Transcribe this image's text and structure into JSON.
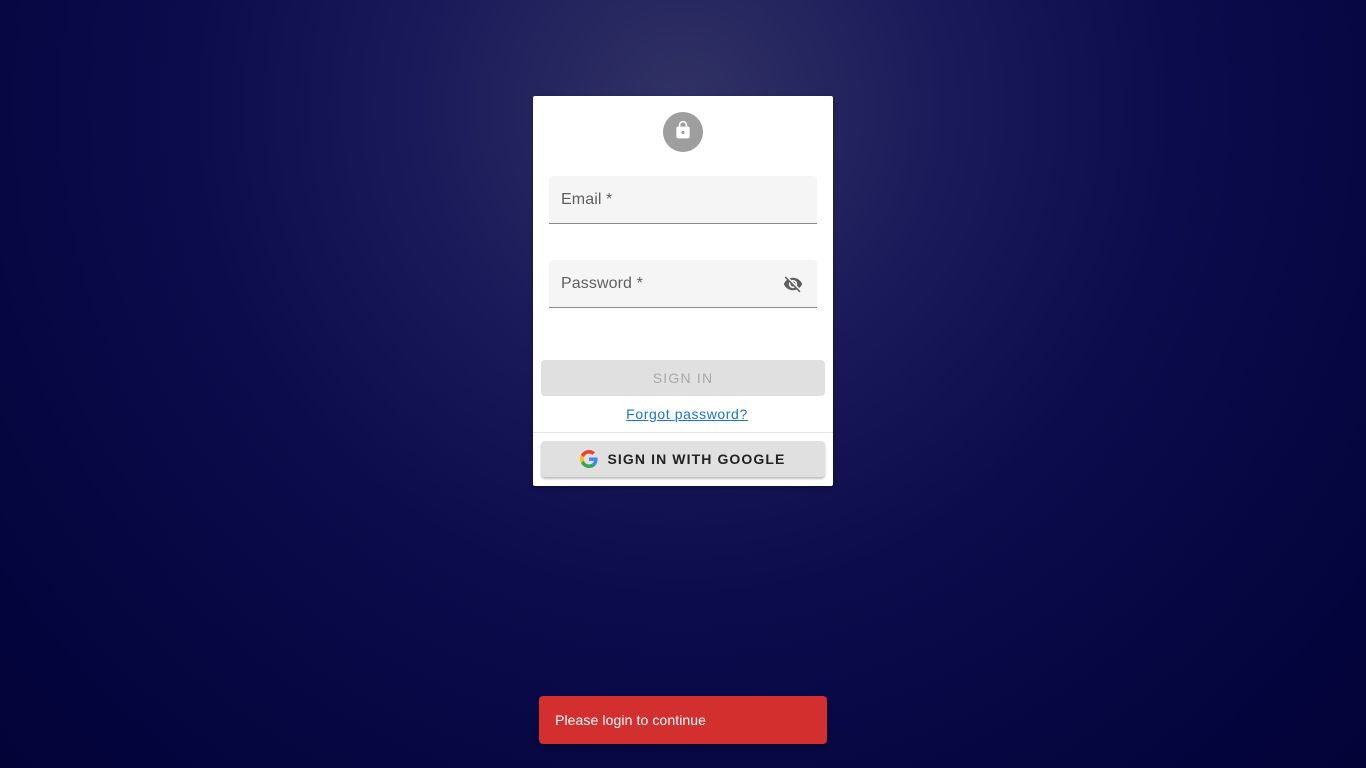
{
  "login": {
    "lock_icon": "lock-icon",
    "email": {
      "label": "Email *",
      "value": ""
    },
    "password": {
      "label": "Password *",
      "value": "",
      "toggle_icon": "visibility-off-icon"
    },
    "signin_label": "SIGN IN",
    "forgot_label": "Forgot password?",
    "google": {
      "icon": "google-icon",
      "label": "SIGN IN WITH GOOGLE"
    }
  },
  "snackbar": {
    "message": "Please login to continue",
    "color": "#d32f2f"
  },
  "colors": {
    "background": "#0c0c4c",
    "link": "#1976d2",
    "button_disabled_bg": "#e0e0e0",
    "avatar_bg": "#9e9e9e"
  }
}
